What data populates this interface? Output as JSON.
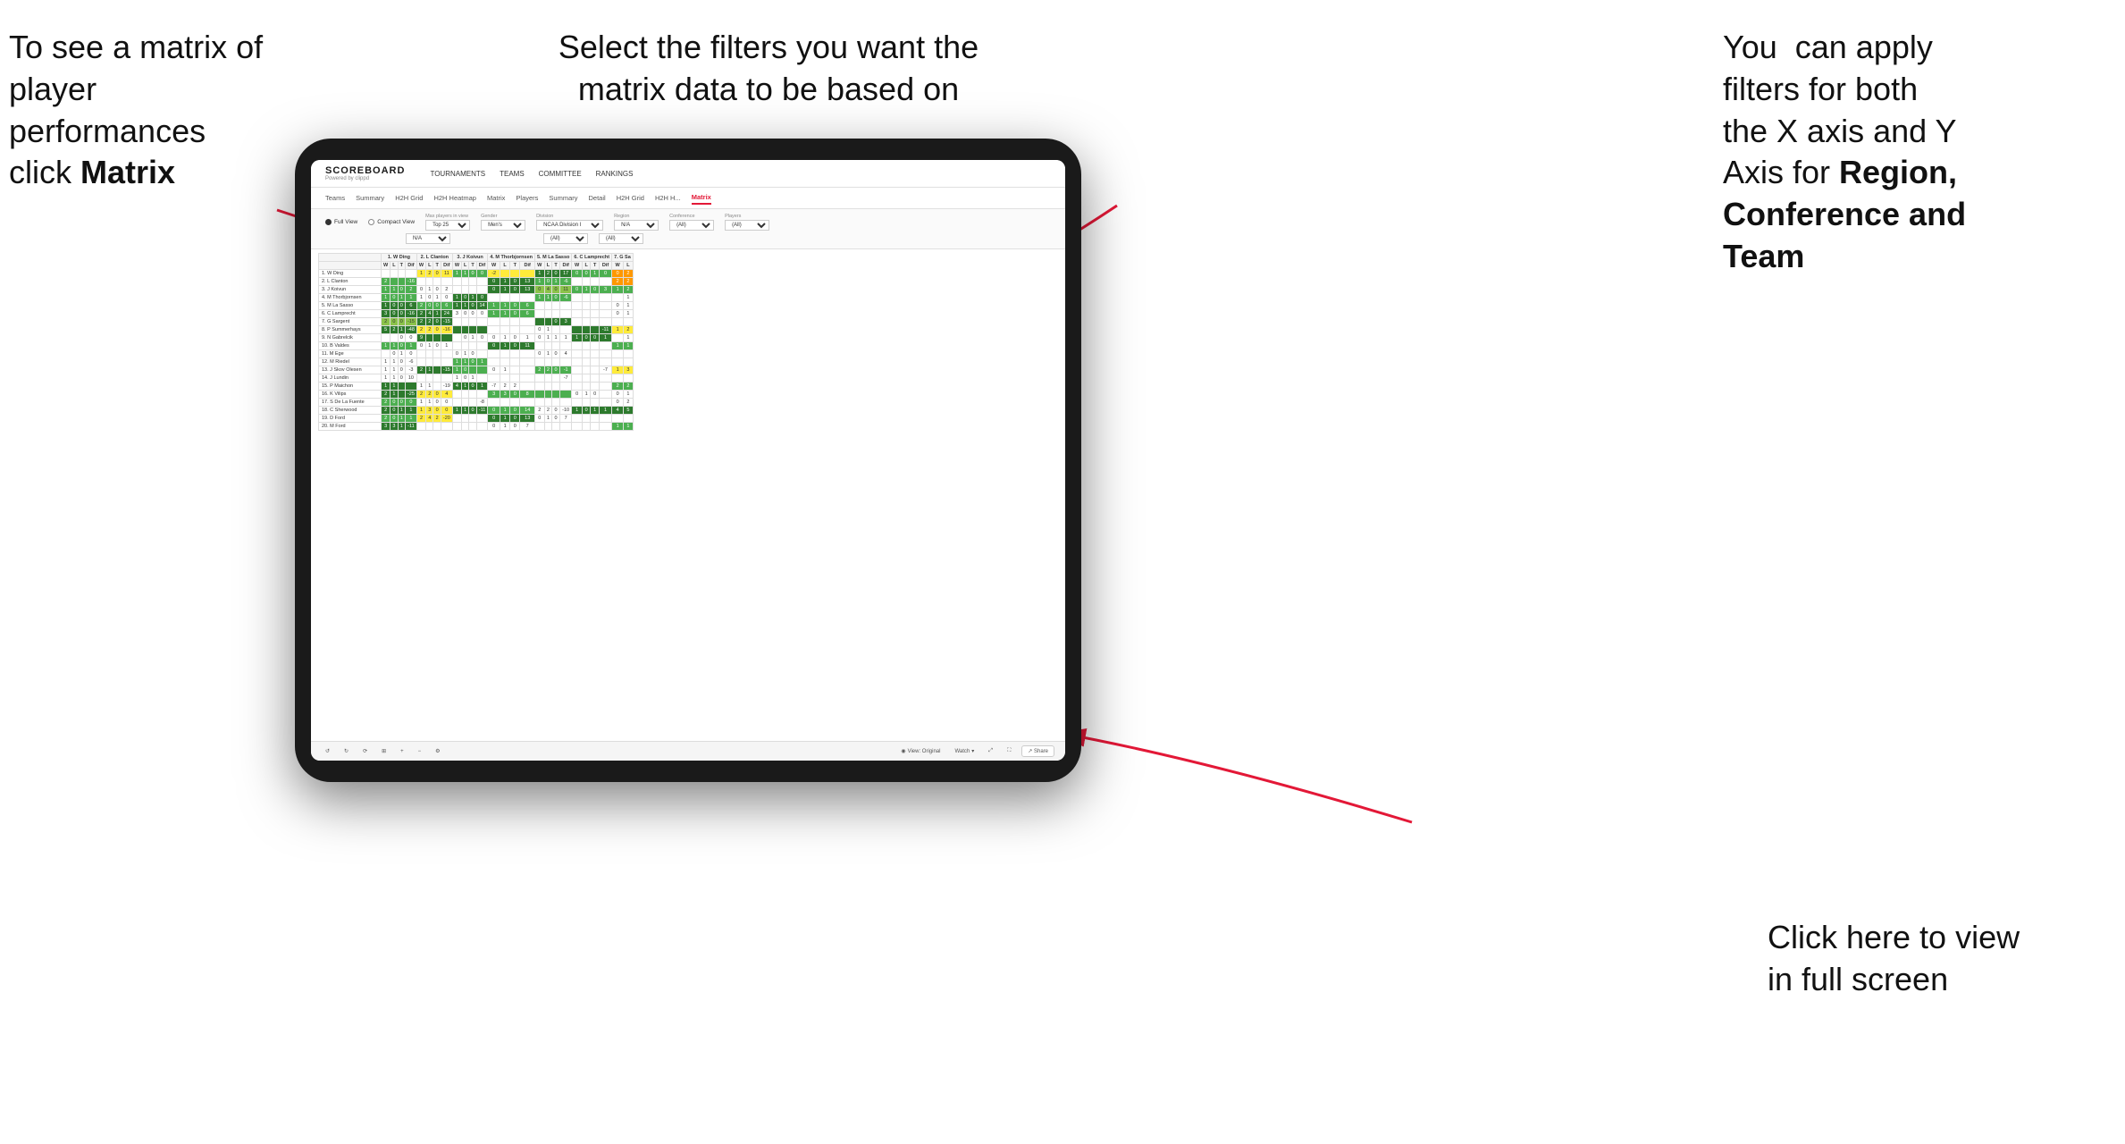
{
  "annotations": {
    "top_left": "To see a matrix of player performances click Matrix",
    "top_left_bold": "Matrix",
    "top_center": "Select the filters you want the matrix data to be based on",
    "top_right_line1": "You  can apply filters for both the X axis and Y Axis for ",
    "top_right_bold": "Region, Conference and Team",
    "bottom_right_line1": "Click here to view in full screen"
  },
  "app": {
    "logo": "SCOREBOARD",
    "logo_sub": "Powered by clippd",
    "nav": [
      "TOURNAMENTS",
      "TEAMS",
      "COMMITTEE",
      "RANKINGS"
    ],
    "sub_nav": [
      "Teams",
      "Summary",
      "H2H Grid",
      "H2H Heatmap",
      "Matrix",
      "Players",
      "Summary",
      "Detail",
      "H2H Grid",
      "H2H H...",
      "Matrix"
    ],
    "active_tab": "Matrix"
  },
  "filters": {
    "view_options": [
      "Full View",
      "Compact View"
    ],
    "selected_view": "Full View",
    "max_players_label": "Max players in view",
    "max_players_value": "Top 25",
    "gender_label": "Gender",
    "gender_value": "Men's",
    "division_label": "Division",
    "division_value": "NCAA Division I",
    "region_label": "Region",
    "region_value": "N/A",
    "conference_label": "Conference",
    "conference_value": "(All)",
    "players_label": "Players",
    "players_value": "(All)"
  },
  "matrix": {
    "col_headers": [
      "1. W Ding",
      "2. L Clanton",
      "3. J Koivun",
      "4. M Thorbjornsen",
      "5. M La Sasso",
      "6. C Lamprecht",
      "7. G Sa"
    ],
    "sub_headers": [
      "W",
      "L",
      "T",
      "Dif"
    ],
    "rows": [
      {
        "name": "1. W Ding",
        "cells": [
          "green",
          "white",
          "white",
          "yellow",
          "white"
        ]
      },
      {
        "name": "2. L Clanton",
        "cells": [
          "green",
          "white",
          "green",
          "yellow",
          "white"
        ]
      },
      {
        "name": "3. J Koivun",
        "cells": [
          "white",
          "green",
          "white",
          "green",
          "white"
        ]
      },
      {
        "name": "4. M Thorbjornsen",
        "cells": [
          "yellow",
          "white",
          "green",
          "white",
          "green"
        ]
      },
      {
        "name": "5. M La Sasso",
        "cells": [
          "white",
          "green",
          "white",
          "green",
          "white"
        ]
      },
      {
        "name": "6. C Lamprecht",
        "cells": [
          "green",
          "white",
          "yellow",
          "white",
          "green"
        ]
      },
      {
        "name": "7. G Sargent",
        "cells": [
          "white",
          "green",
          "white",
          "yellow",
          "white"
        ]
      },
      {
        "name": "8. P Summerhays",
        "cells": [
          "green",
          "yellow",
          "green",
          "white",
          "yellow"
        ]
      },
      {
        "name": "9. N Gabrelcik",
        "cells": [
          "white",
          "white",
          "green",
          "white",
          "white"
        ]
      },
      {
        "name": "10. B Valdes",
        "cells": [
          "green",
          "white",
          "white",
          "green",
          "white"
        ]
      },
      {
        "name": "11. M Ege",
        "cells": [
          "white",
          "green",
          "white",
          "white",
          "green"
        ]
      },
      {
        "name": "12. M Riedel",
        "cells": [
          "green",
          "white",
          "green",
          "white",
          "white"
        ]
      },
      {
        "name": "13. J Skov Olesen",
        "cells": [
          "white",
          "green",
          "white",
          "green",
          "yellow"
        ]
      },
      {
        "name": "14. J Lundin",
        "cells": [
          "green",
          "white",
          "white",
          "white",
          "green"
        ]
      },
      {
        "name": "15. P Maichon",
        "cells": [
          "white",
          "green",
          "yellow",
          "white",
          "white"
        ]
      },
      {
        "name": "16. K Vilips",
        "cells": [
          "green",
          "yellow",
          "white",
          "green",
          "white"
        ]
      },
      {
        "name": "17. S De La Fuente",
        "cells": [
          "white",
          "white",
          "green",
          "white",
          "green"
        ]
      },
      {
        "name": "18. C Sherwood",
        "cells": [
          "green",
          "white",
          "green",
          "yellow",
          "white"
        ]
      },
      {
        "name": "19. D Ford",
        "cells": [
          "white",
          "green",
          "white",
          "green",
          "white"
        ]
      },
      {
        "name": "20. M Ford",
        "cells": [
          "green",
          "white",
          "green",
          "white",
          "yellow"
        ]
      }
    ]
  },
  "toolbar": {
    "view_label": "View: Original",
    "watch_label": "Watch",
    "share_label": "Share"
  }
}
